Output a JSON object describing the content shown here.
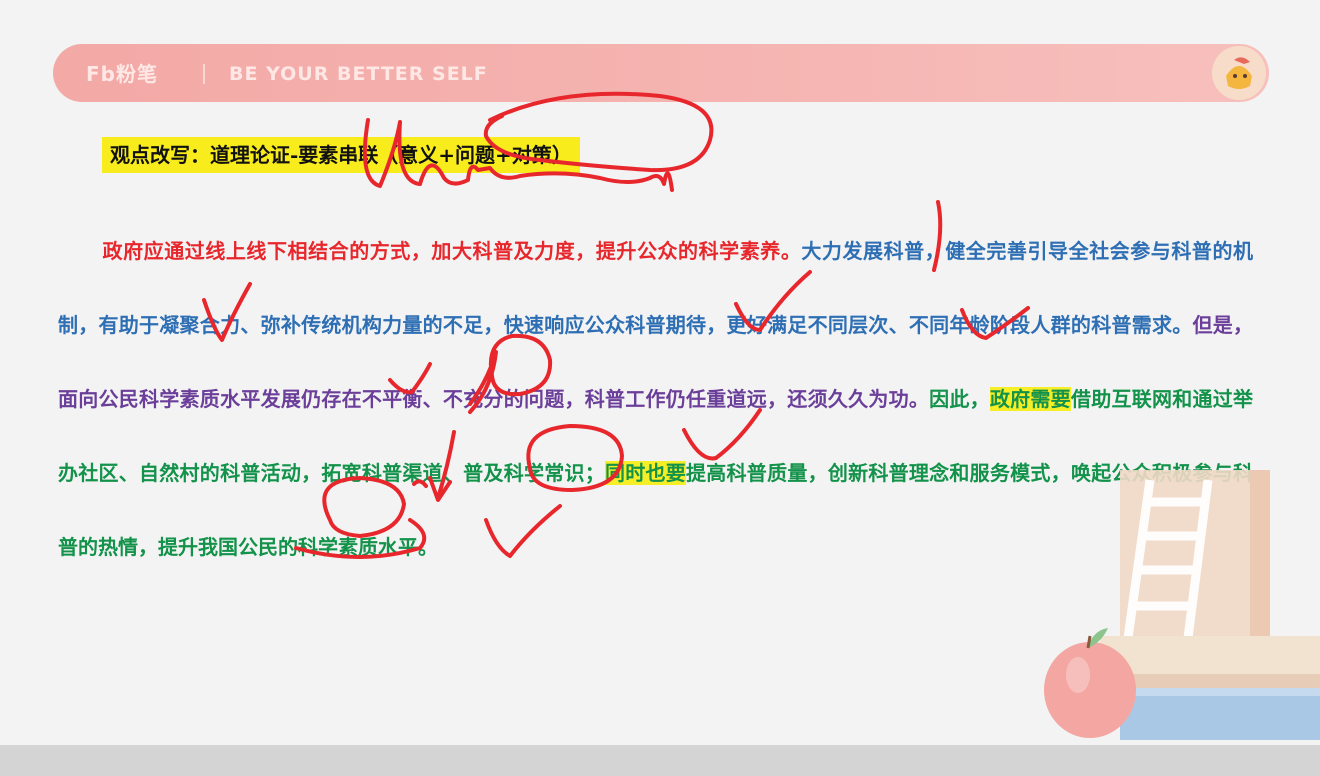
{
  "header": {
    "logo": "Fb粉笔",
    "slogan": "BE YOUR BETTER SELF"
  },
  "title": "观点改写：道理论证-要素串联（意义+问题+对策）",
  "paragraph": {
    "s1": "政府应通过线上线下相结合的方式，加大科普及力度，提升公众的科学素养。",
    "s2": "大力发展科普，健全完善引导全社会参与科普的机制，有助于凝聚合力、弥补传统机构力量的不足，快速响应公众科普期待，更好满足不同层次、不同年龄阶段人群的科普需求。",
    "s3": "但是，面向公民科学素质水平发展仍存在不平衡、不充分的问题，科普工作仍任重道远，还须久久为功。",
    "s4a": "因此，",
    "s4b": "政府需要",
    "s4c": "借助互联网和通过举办社区、自然村的科普活动，拓宽科普渠道、普及科学常识；",
    "s4d": "同时也要",
    "s4e": "提高科普质量，创新科普理念和服务模式，唤起公众积极参与科普的热情，提升我国公民的科学素质水平。"
  },
  "colors": {
    "red": "#e8272c",
    "blue": "#2e6fb4",
    "purple": "#6b3f99",
    "green": "#13924a",
    "highlight": "#f6ee26",
    "banner": "#f3a9a6",
    "ink": "#e8272c"
  }
}
